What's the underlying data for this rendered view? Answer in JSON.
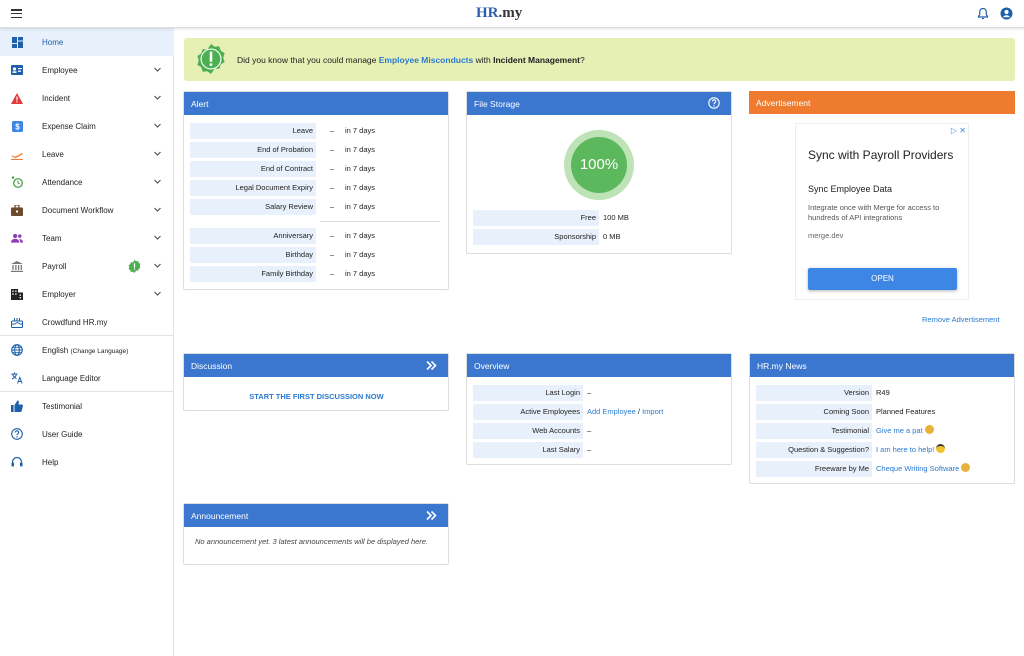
{
  "app": {
    "logo_main": "HR",
    "logo_dot": ".my"
  },
  "sidebar": {
    "items": [
      {
        "label": "Home"
      },
      {
        "label": "Employee"
      },
      {
        "label": "Incident"
      },
      {
        "label": "Expense Claim"
      },
      {
        "label": "Leave"
      },
      {
        "label": "Attendance"
      },
      {
        "label": "Document Workflow"
      },
      {
        "label": "Team"
      },
      {
        "label": "Payroll"
      },
      {
        "label": "Employer"
      },
      {
        "label": "Crowdfund HR.my"
      },
      {
        "label": "English",
        "sublabel": "(Change Language)"
      },
      {
        "label": "Language Editor"
      },
      {
        "label": "Testimonial"
      },
      {
        "label": "User Guide"
      },
      {
        "label": "Help"
      }
    ]
  },
  "banner": {
    "prefix": "Did you know that you could manage ",
    "link": "Employee Misconducts",
    "middle": " with ",
    "bold": "Incident Management",
    "suffix": "?"
  },
  "alert": {
    "title": "Alert",
    "dash": "–",
    "group1": [
      {
        "label": "Leave",
        "value": "in 7 days"
      },
      {
        "label": "End of Probation",
        "value": "in 7 days"
      },
      {
        "label": "End of Contract",
        "value": "in 7 days"
      },
      {
        "label": "Legal Document Expiry",
        "value": "in 7 days"
      },
      {
        "label": "Salary Review",
        "value": "in 7 days"
      }
    ],
    "group2": [
      {
        "label": "Anniversary",
        "value": "in 7 days"
      },
      {
        "label": "Birthday",
        "value": "in 7 days"
      },
      {
        "label": "Family Birthday",
        "value": "in 7 days"
      }
    ]
  },
  "storage": {
    "title": "File Storage",
    "percent": "100%",
    "rows": [
      {
        "label": "Free",
        "value": "100 MB"
      },
      {
        "label": "Sponsorship",
        "value": "0 MB"
      }
    ]
  },
  "ad": {
    "header": "Advertisement",
    "title": "Sync with Payroll Providers",
    "subtitle": "Sync Employee Data",
    "desc": "Integrate once with Merge for access to hundreds of API integrations",
    "domain": "merge.dev",
    "button": "OPEN",
    "remove": "Remove Advertisement"
  },
  "discussion": {
    "title": "Discussion",
    "cta": "START THE FIRST DISCUSSION NOW"
  },
  "overview": {
    "title": "Overview",
    "last_login_label": "Last Login",
    "last_login_value": "–",
    "active_label": "Active Employees",
    "add_link": "Add Employee",
    "slash": "/",
    "import_link": "Import",
    "web_label": "Web Accounts",
    "web_value": "–",
    "salary_label": "Last Salary",
    "salary_value": "–"
  },
  "news": {
    "title": "HR.my News",
    "rows": [
      {
        "label": "Version",
        "value": "R49"
      },
      {
        "label": "Coming Soon",
        "value": "Planned Features"
      },
      {
        "label": "Testimonial",
        "value": "Give me a pat"
      },
      {
        "label": "Question & Suggestion?",
        "value": "I am here to help!"
      },
      {
        "label": "Freeware by Me",
        "value": "Cheque Writing Software"
      }
    ]
  },
  "announcement": {
    "title": "Announcement",
    "text": "No announcement yet. 3 latest announcements will be displayed here."
  },
  "colors": {
    "header_blue": "#3c77cf",
    "ad_orange": "#ee7b2e",
    "banner_bg": "#e6efb4",
    "link": "#2a7bd0"
  }
}
